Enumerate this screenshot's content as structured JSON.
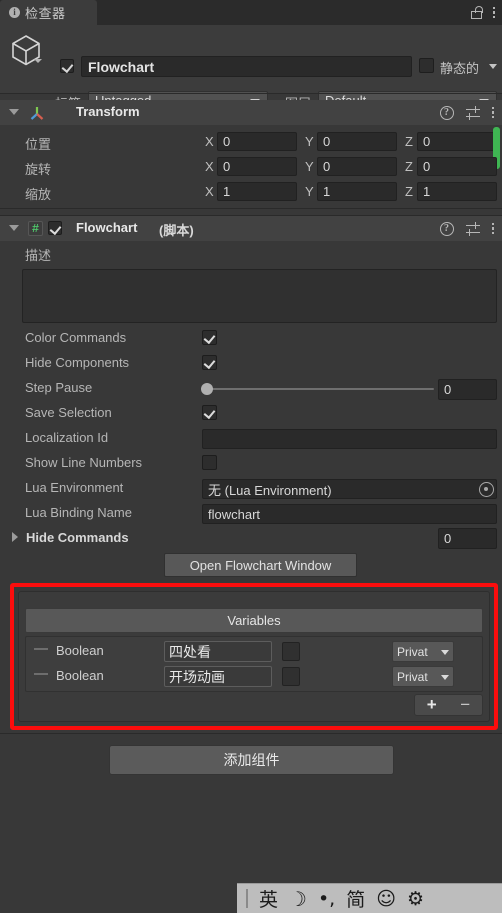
{
  "window": {
    "tab_label": "检查器",
    "info_icon": "info-icon",
    "lock_icon": "lock-open-icon",
    "menu_icon": "kebab-menu-icon"
  },
  "gameobject": {
    "icon": "cube-icon",
    "enabled": true,
    "name_value": "Flowchart",
    "static_label": "静态的",
    "static_checked": false,
    "tag_label": "标签",
    "tag_value": "Untagged",
    "layer_label": "图层",
    "layer_value": "Default"
  },
  "transform": {
    "title": "Transform",
    "icon": "transform-axis-icon",
    "rows": [
      {
        "label": "位置",
        "x": "0",
        "y": "0",
        "z": "0"
      },
      {
        "label": "旋转",
        "x": "0",
        "y": "0",
        "z": "0"
      },
      {
        "label": "缩放",
        "x": "1",
        "y": "1",
        "z": "1"
      }
    ],
    "axis_labels": {
      "x": "X",
      "y": "Y",
      "z": "Z"
    },
    "help_icon": "help-icon",
    "preset_icon": "preset-settings-icon",
    "menu_icon": "kebab-menu-icon"
  },
  "flowchart_component": {
    "title": "Flowchart",
    "subtitle": "(脚本)",
    "icon": "csharp-script-icon",
    "enabled": true,
    "description_label": "描述",
    "description_value": "",
    "properties": [
      {
        "label": "Color Commands",
        "kind": "checkbox",
        "checked": true
      },
      {
        "label": "Hide Components",
        "kind": "checkbox",
        "checked": true
      },
      {
        "label": "Step Pause",
        "kind": "slider",
        "value": "0"
      },
      {
        "label": "Save Selection",
        "kind": "checkbox",
        "checked": true
      },
      {
        "label": "Localization Id",
        "kind": "text",
        "value": ""
      },
      {
        "label": "Show Line Numbers",
        "kind": "checkbox",
        "checked": false
      },
      {
        "label": "Lua Environment",
        "kind": "object",
        "value": "无 (Lua Environment)"
      },
      {
        "label": "Lua Binding Name",
        "kind": "text",
        "value": "flowchart"
      },
      {
        "label": "Hide Commands",
        "kind": "foldout_array",
        "value": "0"
      }
    ],
    "open_window_button": "Open Flowchart Window"
  },
  "variables": {
    "header": "Variables",
    "rows": [
      {
        "type": "Boolean",
        "key": "四处看",
        "value_checked": false,
        "scope": "Privat"
      },
      {
        "type": "Boolean",
        "key": "开场动画",
        "value_checked": false,
        "scope": "Privat"
      }
    ],
    "add_label": "+",
    "remove_label": "−",
    "highlight_color": "#fb0d0d"
  },
  "footer": {
    "add_component_label": "添加组件"
  },
  "ime_bar": {
    "items": [
      "英",
      "☽",
      "•,",
      "简",
      "☺",
      "⚙"
    ]
  }
}
